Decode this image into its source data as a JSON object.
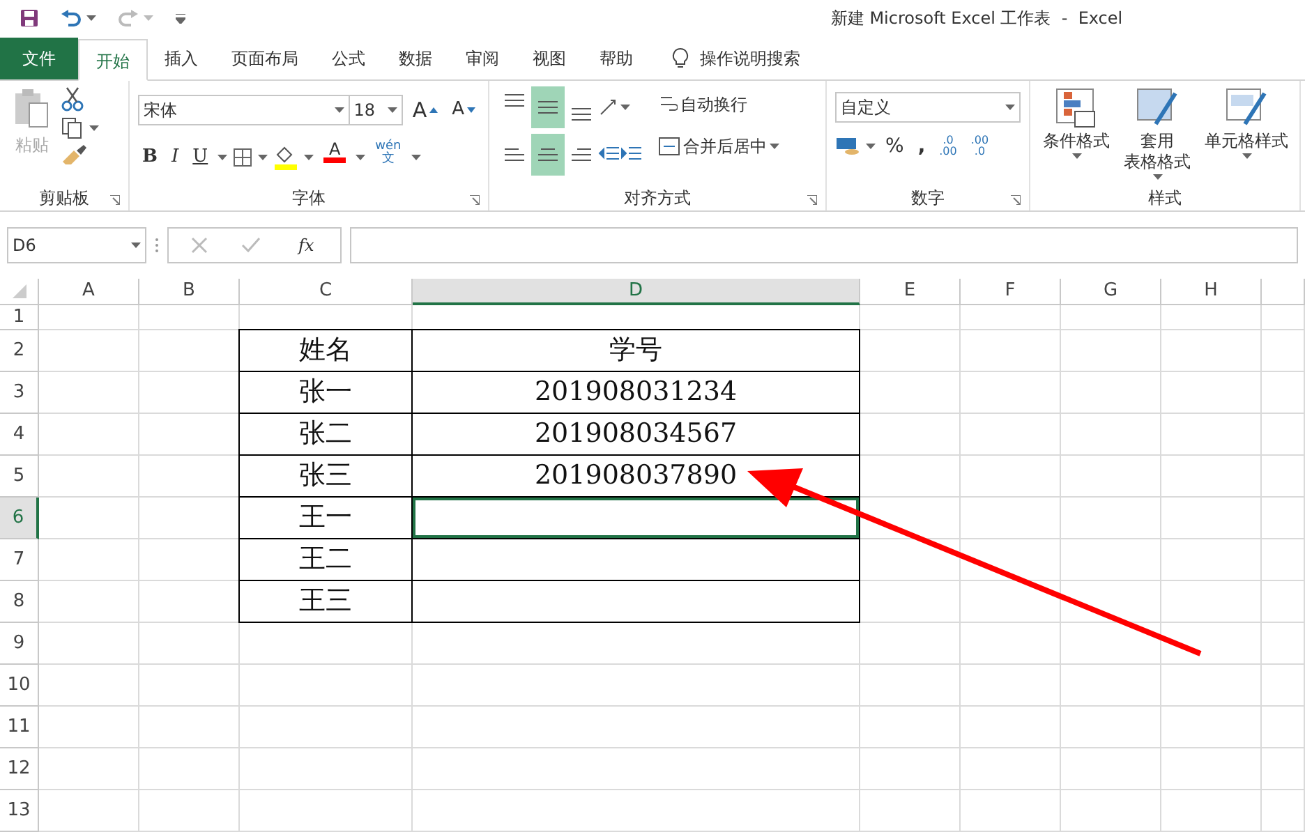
{
  "window": {
    "title": "新建 Microsoft Excel 工作表  -  Excel"
  },
  "tabs": [
    {
      "label": "文件",
      "kind": "file",
      "selected": false
    },
    {
      "label": "开始",
      "kind": "tab",
      "selected": true
    },
    {
      "label": "插入",
      "kind": "tab",
      "selected": false
    },
    {
      "label": "页面布局",
      "kind": "tab",
      "selected": false
    },
    {
      "label": "公式",
      "kind": "tab",
      "selected": false
    },
    {
      "label": "数据",
      "kind": "tab",
      "selected": false
    },
    {
      "label": "审阅",
      "kind": "tab",
      "selected": false
    },
    {
      "label": "视图",
      "kind": "tab",
      "selected": false
    },
    {
      "label": "帮助",
      "kind": "tab",
      "selected": false
    }
  ],
  "tell_me": "操作说明搜索",
  "ribbon": {
    "clipboard": {
      "paste": "粘贴",
      "paste_disabled": true,
      "label": "剪贴板"
    },
    "font": {
      "font_name": "宋体",
      "font_size": "18",
      "grow": "A",
      "shrink": "A",
      "bold": "B",
      "italic": "I",
      "underline": "U",
      "font_color": "A",
      "phonetic": [
        "wén",
        "文"
      ],
      "label": "字体"
    },
    "alignment": {
      "vertical": [
        {
          "selected": false
        },
        {
          "selected": true
        },
        {
          "selected": false
        }
      ],
      "horizontal": [
        {
          "selected": false
        },
        {
          "selected": true
        },
        {
          "selected": false
        }
      ],
      "wrap_text": "自动换行",
      "merge": "合并后居中",
      "label": "对齐方式"
    },
    "number": {
      "format": "自定义",
      "percent": "%",
      "comma": ",",
      "decimals": [
        ".0\n.00",
        ".00\n.0"
      ],
      "label": "数字"
    },
    "styles": {
      "buttons": [
        {
          "lines": [
            "条件格式"
          ]
        },
        {
          "lines": [
            "套用",
            "表格格式"
          ]
        },
        {
          "lines": [
            "单元格样式"
          ]
        }
      ],
      "label": "样式"
    }
  },
  "formula_bar": {
    "name_box": "D6",
    "fx": "fx"
  },
  "sheet": {
    "columns": [
      {
        "label": "A",
        "selected": false
      },
      {
        "label": "B",
        "selected": false
      },
      {
        "label": "C",
        "selected": false
      },
      {
        "label": "D",
        "selected": true
      },
      {
        "label": "E",
        "selected": false
      },
      {
        "label": "F",
        "selected": false
      },
      {
        "label": "G",
        "selected": false
      },
      {
        "label": "H",
        "selected": false
      }
    ],
    "rows": [
      {
        "label": "1",
        "selected": false
      },
      {
        "label": "2",
        "selected": false
      },
      {
        "label": "3",
        "selected": false
      },
      {
        "label": "4",
        "selected": false
      },
      {
        "label": "5",
        "selected": false
      },
      {
        "label": "6",
        "selected": true
      },
      {
        "label": "7",
        "selected": false
      },
      {
        "label": "8",
        "selected": false
      },
      {
        "label": "9",
        "selected": false
      },
      {
        "label": "10",
        "selected": false
      },
      {
        "label": "11",
        "selected": false
      },
      {
        "label": "12",
        "selected": false
      },
      {
        "label": "13",
        "selected": false
      }
    ],
    "table": [
      {
        "cells": [
          {
            "text": "姓名",
            "selected": false
          },
          {
            "text": "学号",
            "selected": false
          }
        ]
      },
      {
        "cells": [
          {
            "text": "张一",
            "selected": false
          },
          {
            "text": "201908031234",
            "selected": false
          }
        ]
      },
      {
        "cells": [
          {
            "text": "张二",
            "selected": false
          },
          {
            "text": "201908034567",
            "selected": false
          }
        ]
      },
      {
        "cells": [
          {
            "text": "张三",
            "selected": false
          },
          {
            "text": "201908037890",
            "selected": false
          }
        ]
      },
      {
        "cells": [
          {
            "text": "王一",
            "selected": false
          },
          {
            "selected": true
          }
        ]
      },
      {
        "cells": [
          {
            "text": "王二",
            "selected": false
          },
          {
            "selected": false
          }
        ]
      },
      {
        "cells": [
          {
            "text": "王三",
            "selected": false
          },
          {
            "selected": false
          }
        ]
      }
    ]
  }
}
